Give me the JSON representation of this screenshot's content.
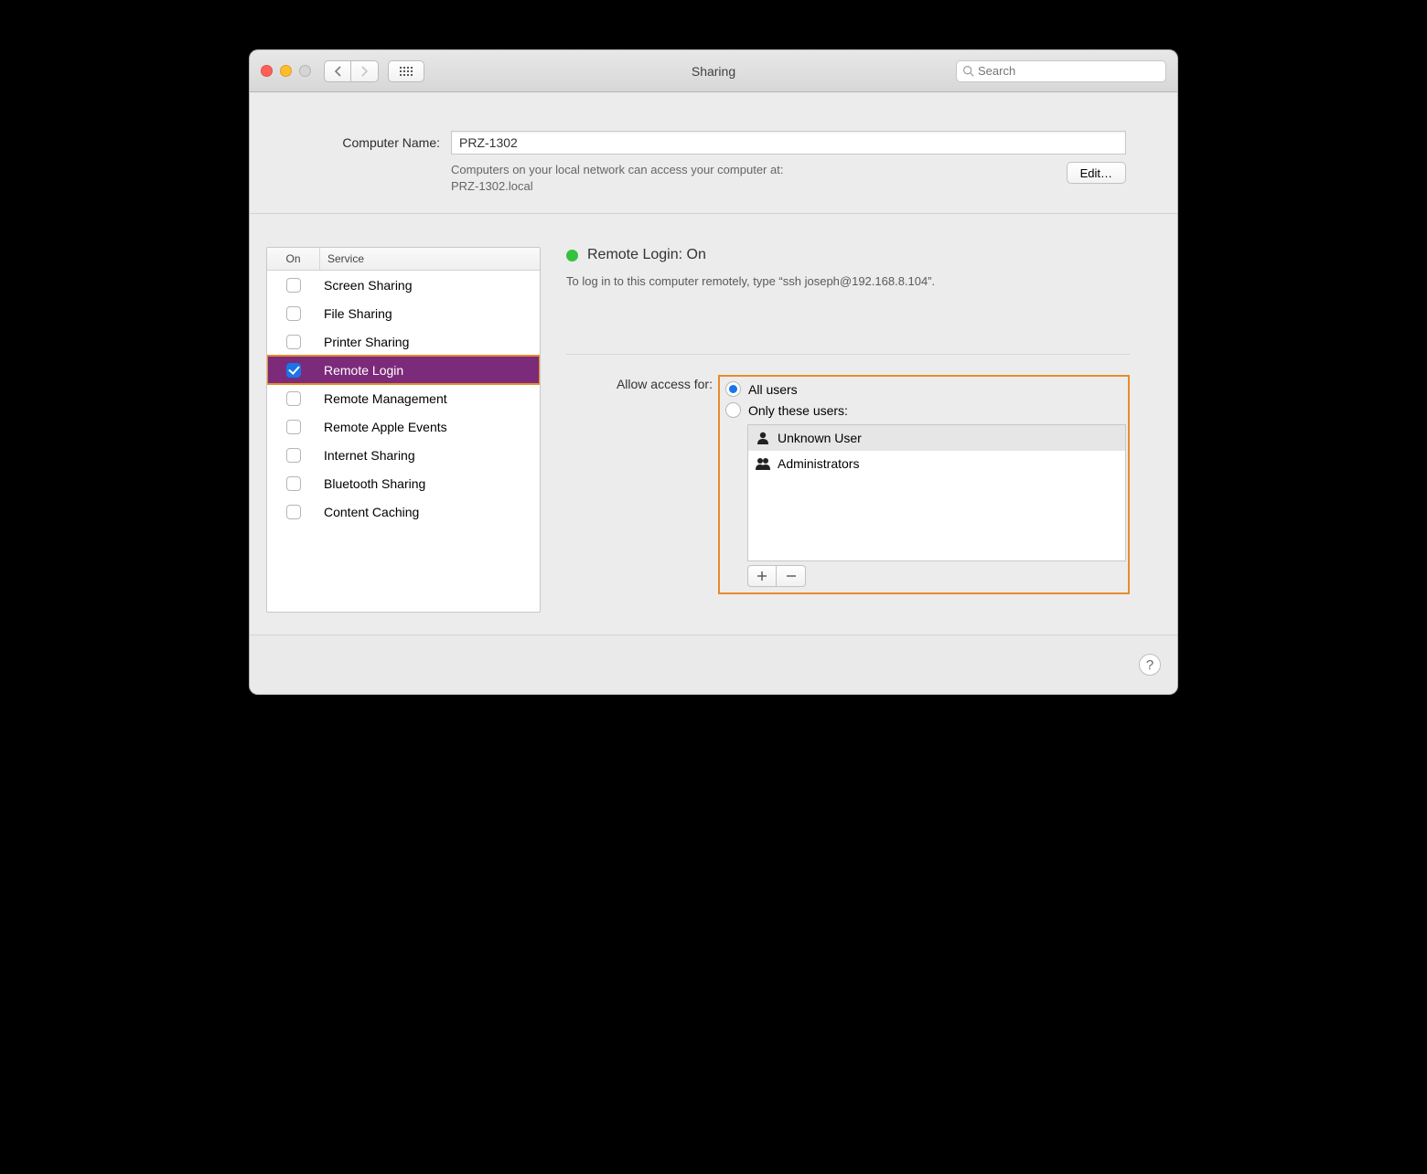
{
  "window": {
    "title": "Sharing",
    "search_placeholder": "Search"
  },
  "computer_name": {
    "label": "Computer Name:",
    "value": "PRZ-1302",
    "hint_line1": "Computers on your local network can access your computer at:",
    "hint_line2": "PRZ-1302.local",
    "edit_label": "Edit…"
  },
  "services_header": {
    "on": "On",
    "service": "Service"
  },
  "services": [
    {
      "on": false,
      "label": "Screen Sharing",
      "selected": false
    },
    {
      "on": false,
      "label": "File Sharing",
      "selected": false
    },
    {
      "on": false,
      "label": "Printer Sharing",
      "selected": false
    },
    {
      "on": true,
      "label": "Remote Login",
      "selected": true
    },
    {
      "on": false,
      "label": "Remote Management",
      "selected": false
    },
    {
      "on": false,
      "label": "Remote Apple Events",
      "selected": false
    },
    {
      "on": false,
      "label": "Internet Sharing",
      "selected": false
    },
    {
      "on": false,
      "label": "Bluetooth Sharing",
      "selected": false
    },
    {
      "on": false,
      "label": "Content Caching",
      "selected": false
    }
  ],
  "detail": {
    "status_title": "Remote Login: On",
    "instruction": "To log in to this computer remotely, type “ssh joseph@192.168.8.104”.",
    "access_label": "Allow access for:",
    "radio_all": "All users",
    "radio_only": "Only these users:",
    "users": [
      {
        "label": "Unknown User",
        "type": "single"
      },
      {
        "label": "Administrators",
        "type": "group"
      }
    ]
  },
  "help_label": "?"
}
